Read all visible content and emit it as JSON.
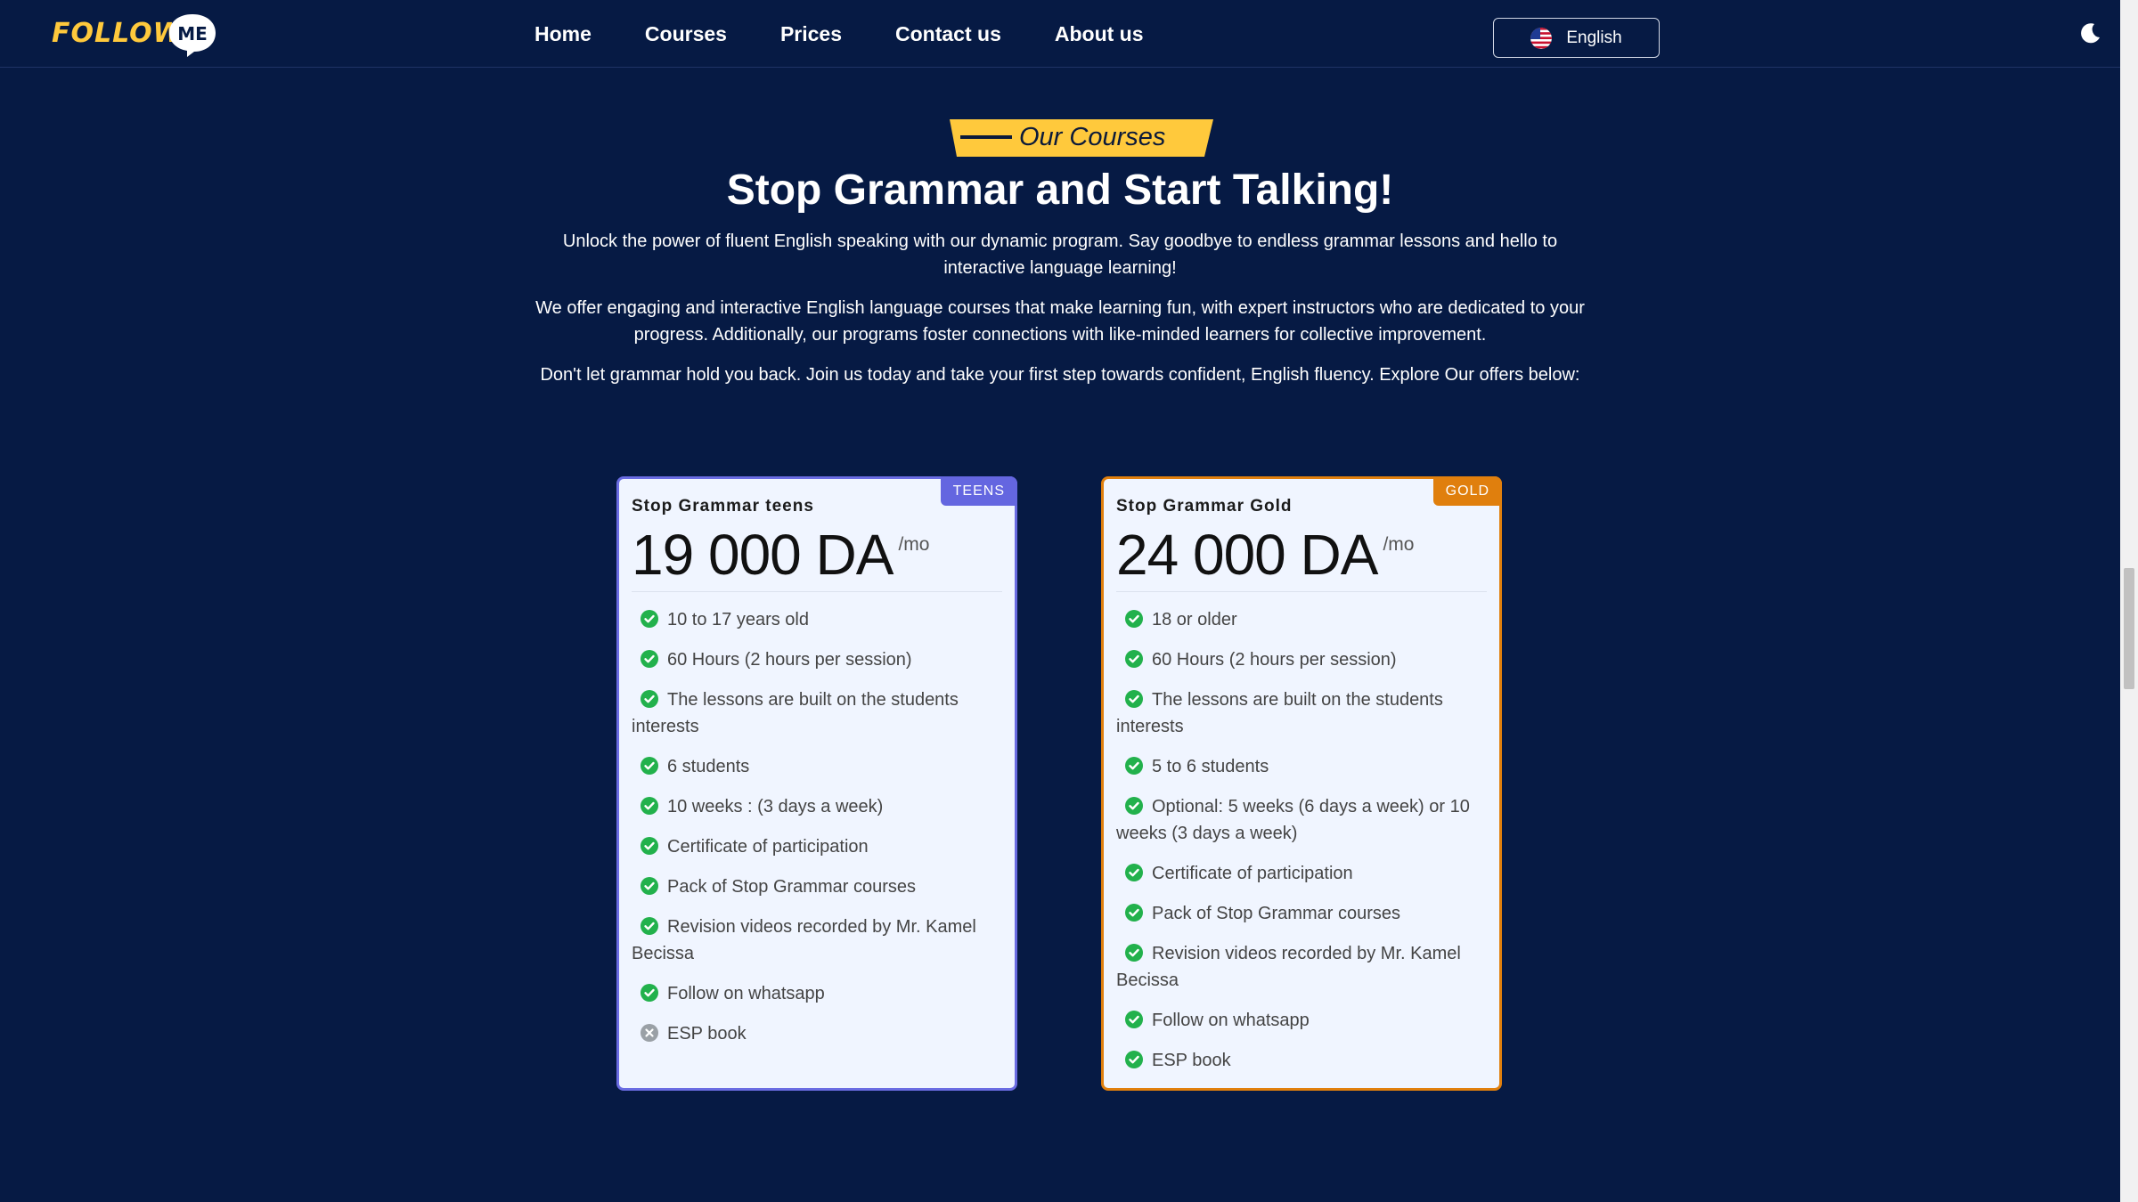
{
  "brand": {
    "logo_text": "FOLLOW",
    "logo_bubble_text": "ME"
  },
  "nav": {
    "links": [
      "Home",
      "Courses",
      "Prices",
      "Contact us",
      "About us"
    ],
    "language": "English"
  },
  "hero": {
    "tag": "Our Courses",
    "title": "Stop Grammar and Start Talking!",
    "paragraphs": [
      "Unlock the power of fluent English speaking with our dynamic program. Say goodbye to endless grammar lessons and hello to interactive language learning!",
      "We offer engaging and interactive English language courses that make learning fun, with expert instructors who are dedicated to your progress. Additionally, our programs foster connections with like-minded learners for collective improvement.",
      "Don't let grammar hold you back. Join us today and take your first step towards confident, English fluency. Explore Our offers below:"
    ]
  },
  "plans": [
    {
      "badge": "TEENS",
      "name": "Stop Grammar teens",
      "price": "19 000 DA",
      "period": "/mo",
      "features": [
        "10 to 17 years old",
        "60 Hours (2 hours per session)",
        "The lessons are built on the students interests",
        "6 students",
        "10 weeks : (3 days a week)",
        "Certificate of participation",
        "Pack of Stop Grammar courses",
        "Revision videos recorded by Mr. Kamel Becissa",
        "Follow on whatsapp",
        "ESP book"
      ],
      "included": [
        true,
        true,
        true,
        true,
        true,
        true,
        true,
        true,
        true,
        false
      ]
    },
    {
      "badge": "GOLD",
      "name": "Stop Grammar Gold",
      "price": "24 000 DA",
      "period": "/mo",
      "features": [
        "18 or older",
        "60 Hours (2 hours per session)",
        "The lessons are built on the students interests",
        "5 to 6 students",
        "Optional: 5 weeks (6 days a week) or 10 weeks (3 days a week)",
        "Certificate of participation",
        "Pack of Stop Grammar courses",
        "Revision videos recorded by Mr. Kamel Becissa",
        "Follow on whatsapp",
        "ESP book"
      ],
      "included": [
        true,
        true,
        true,
        true,
        true,
        true,
        true,
        true,
        true,
        true
      ]
    }
  ],
  "colors": {
    "background": "#061a44",
    "accent_yellow": "#ffc93c",
    "teens": "#6466e0",
    "gold": "#e07f0d",
    "check": "#22b14c",
    "cross": "#9aa0a6"
  },
  "icons": {
    "theme_toggle": "moon-icon",
    "language_flag": "us-flag-icon",
    "included": "check-circle-icon",
    "excluded": "x-circle-icon"
  }
}
